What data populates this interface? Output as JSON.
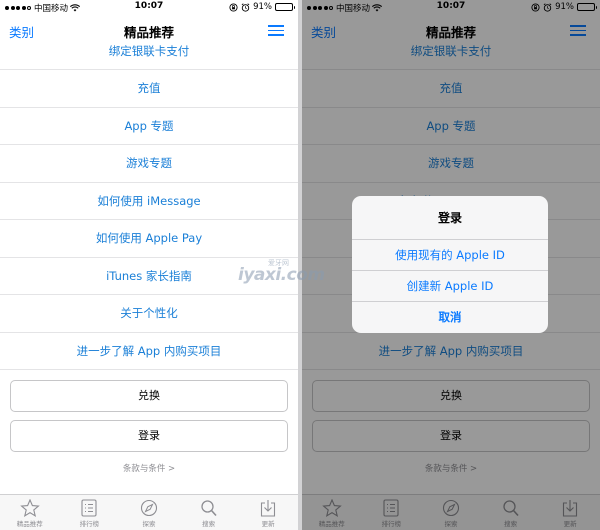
{
  "status_bar": {
    "carrier": "中国移动",
    "time": "10:07",
    "battery": "91%",
    "battery_level": 0.91
  },
  "nav": {
    "back_label": "类别",
    "title": "精品推荐"
  },
  "menu_items": [
    "绑定银联卡支付",
    "充值",
    "App 专题",
    "游戏专题",
    "如何使用 iMessage",
    "如何使用 Apple Pay",
    "iTunes 家长指南",
    "关于个性化",
    "进一步了解 App 内购买项目"
  ],
  "buttons": {
    "redeem": "兑换",
    "sign_in": "登录"
  },
  "terms_link": "条款与条件 >",
  "tabs": [
    {
      "label": "精品推荐",
      "icon": "star-icon"
    },
    {
      "label": "排行榜",
      "icon": "list-icon"
    },
    {
      "label": "探索",
      "icon": "compass-icon"
    },
    {
      "label": "搜索",
      "icon": "search-icon"
    },
    {
      "label": "更新",
      "icon": "download-icon"
    }
  ],
  "alert": {
    "title": "登录",
    "options": [
      "使用现有的 Apple ID",
      "创建新 Apple ID"
    ],
    "cancel": "取消"
  },
  "watermark": {
    "text": "iyaxi.com",
    "subtext": "爱牙网"
  },
  "colors": {
    "link_blue": "#1a7fd7",
    "ios_blue": "#0a7aff",
    "gray_text": "#8e8e93"
  }
}
